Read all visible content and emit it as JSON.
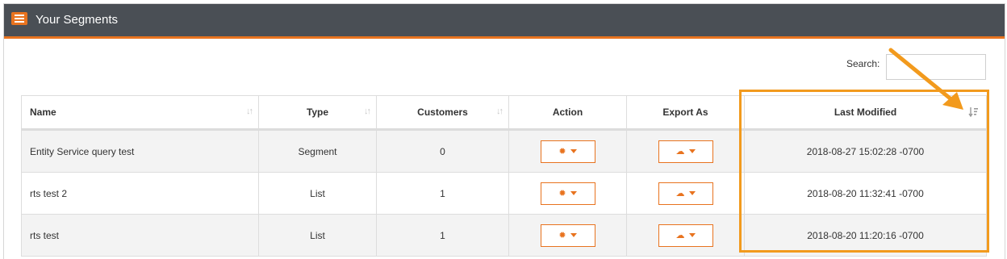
{
  "header": {
    "title": "Your Segments",
    "icon": "list-icon"
  },
  "search": {
    "label": "Search:",
    "value": ""
  },
  "table": {
    "columns": [
      "Name",
      "Type",
      "Customers",
      "Action",
      "Export As",
      "Last Modified"
    ],
    "rows": [
      {
        "name": "Entity Service query test",
        "type": "Segment",
        "customers": "0",
        "last_modified": "2018-08-27 15:02:28 -0700"
      },
      {
        "name": "rts test 2",
        "type": "List",
        "customers": "1",
        "last_modified": "2018-08-20 11:32:41 -0700"
      },
      {
        "name": "rts test",
        "type": "List",
        "customers": "1",
        "last_modified": "2018-08-20 11:20:16 -0700"
      }
    ]
  },
  "icons": {
    "action": "gear-icon",
    "export": "cloud-download-icon",
    "sort": "sort-icon",
    "sort_active": "sort-desc-icon"
  },
  "colors": {
    "accent": "#e8731f",
    "header_bg": "#4a4f55",
    "highlight": "#f29a1d"
  }
}
